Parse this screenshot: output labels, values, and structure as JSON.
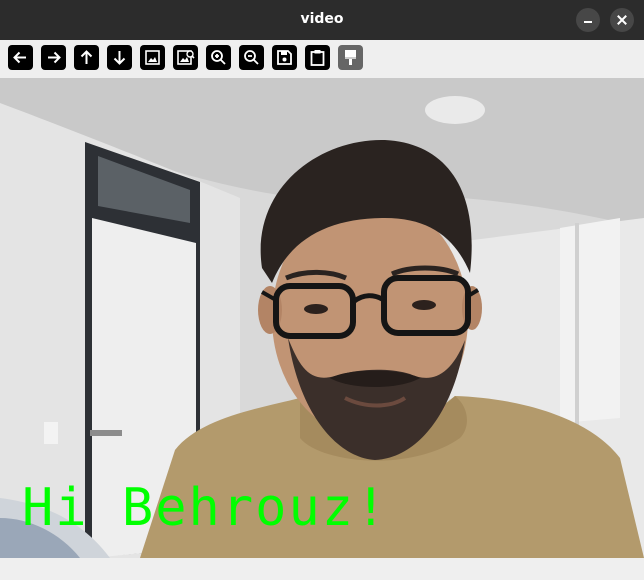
{
  "window": {
    "title": "video"
  },
  "toolbar": {
    "tools": [
      {
        "name": "pan-left",
        "icon": "arrow-left-icon"
      },
      {
        "name": "pan-right",
        "icon": "arrow-right-icon"
      },
      {
        "name": "pan-up",
        "icon": "arrow-up-icon"
      },
      {
        "name": "pan-down",
        "icon": "arrow-down-icon"
      },
      {
        "name": "zoom-fit",
        "icon": "image-icon"
      },
      {
        "name": "zoom-original",
        "icon": "image-search-icon"
      },
      {
        "name": "zoom-in",
        "icon": "zoom-in-icon"
      },
      {
        "name": "zoom-out",
        "icon": "zoom-out-icon"
      },
      {
        "name": "save",
        "icon": "save-icon"
      },
      {
        "name": "copy",
        "icon": "clipboard-icon"
      },
      {
        "name": "properties",
        "icon": "paint-brush-icon",
        "disabled": true
      }
    ]
  },
  "video": {
    "overlay_text": "Hi Behrouz!",
    "overlay_color": "#00ff00"
  }
}
